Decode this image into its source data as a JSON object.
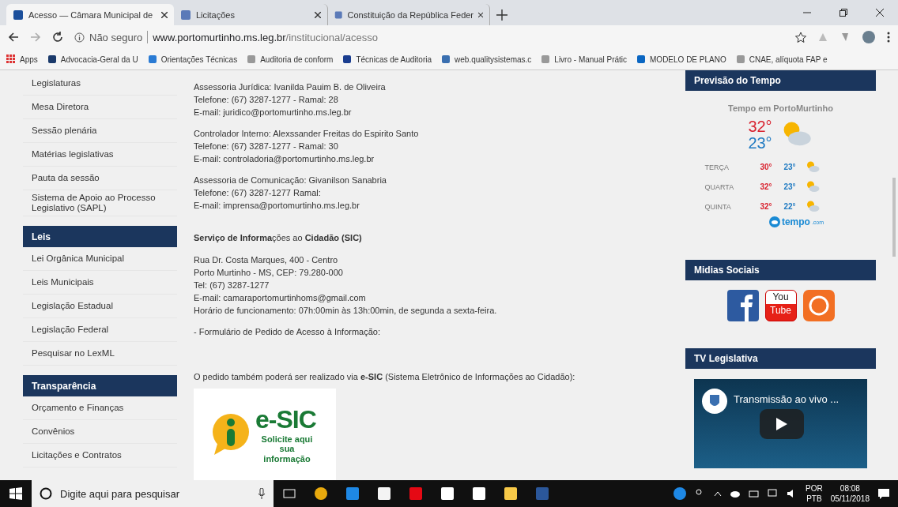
{
  "browser": {
    "tabs": [
      {
        "title": "Acesso — Câmara Municipal de",
        "selected": true
      },
      {
        "title": "Licitações",
        "selected": false
      },
      {
        "title": "Constituição da República Feder",
        "selected": false
      }
    ],
    "address": {
      "security": "Não seguro",
      "host": "www.portomurtinho.ms.leg.br",
      "path": "/institucional/acesso"
    },
    "bookmarks": [
      "Apps",
      "Advocacia-Geral da U",
      "Orientações Técnicas",
      "Auditoria de conform",
      "Técnicas de Auditoria",
      "web.qualitysistemas.c",
      "Livro - Manual Prátic",
      "MODELO DE PLANO",
      "CNAE, alíquota FAP e"
    ]
  },
  "sidebar": {
    "groups": [
      {
        "items": [
          "Legislaturas",
          "Mesa Diretora",
          "Sessão plenária",
          "Matérias legislativas",
          "Pauta da sessão",
          "Sistema de Apoio ao Processo Legislativo (SAPL)"
        ]
      },
      {
        "title": "Leis",
        "items": [
          "Lei Orgânica Municipal",
          "Leis Municipais",
          "Legislação Estadual",
          "Legislação Federal",
          "Pesquisar no LexML"
        ]
      },
      {
        "title": "Transparência",
        "items": [
          "Orçamento e Finanças",
          "Convênios",
          "Licitações e Contratos"
        ]
      }
    ]
  },
  "content": {
    "blocks": [
      {
        "kind": "lines",
        "lines": [
          "Assessoria Jurídica: Ivanilda Pauim B. de Oliveira",
          "Telefone: (67) 3287-1277 - Ramal: 28",
          "E-mail: juridico@portomurtinho.ms.leg.br"
        ]
      },
      {
        "kind": "lines",
        "lines": [
          "Controlador Interno: Alexssander Freitas do Espirito Santo",
          "Telefone: (67) 3287-1277 - Ramal: 30",
          "E-mail: controladoria@portomurtinho.ms.leg.br"
        ]
      },
      {
        "kind": "lines",
        "lines": [
          "Assessoria de Comunicação: Givanilson Sanabria",
          "Telefone: (67) 3287-1277 Ramal:",
          "E-mail: imprensa@portomurtinho.ms.leg.br"
        ]
      },
      {
        "kind": "heading",
        "text": "**Serviço de Informa**ções ao **Cidadão (SIC)**"
      },
      {
        "kind": "lines",
        "lines": [
          "Rua Dr. Costa Marques, 400 - Centro",
          "Porto Murtinho - MS, CEP: 79.280-000",
          "Tel: (67) 3287-1277",
          "E-mail: camaraportomurtinhoms@gmail.com",
          "Horário de funcionamento: 07h:00min às 13h:00min, de segunda a sexta-feira."
        ]
      },
      {
        "kind": "lines",
        "lines": [
          "- Formulário de Pedido de Acesso à Informação:"
        ]
      },
      {
        "kind": "spaced",
        "lines": [
          "O pedido também poderá ser realizado via **e-SIC** (Sistema Eletrônico de Informações ao Cidadão):"
        ]
      },
      {
        "kind": "banner",
        "title": "e-SIC",
        "subtitle": "Solicite aqui sua informação"
      }
    ]
  },
  "weather": {
    "title": "Previsão do Tempo",
    "place": "Tempo em PortoMurtinho",
    "high": "32°",
    "low": "23°",
    "days": [
      {
        "day": "TERÇA",
        "high": "30°",
        "low": "23°"
      },
      {
        "day": "QUARTA",
        "high": "32°",
        "low": "23°"
      },
      {
        "day": "QUINTA",
        "high": "32°",
        "low": "22°"
      }
    ],
    "brand": "tempo",
    "brand_suffix": ".com"
  },
  "social": {
    "title": "Midias Sociais",
    "youtube_top": "You",
    "youtube_bottom": "Tube"
  },
  "tv": {
    "title": "TV Legislativa",
    "video_title": "Transmissão ao vivo ..."
  },
  "taskbar": {
    "search_placeholder": "Digite aqui para pesquisar",
    "language": "POR",
    "layout": "PTB",
    "time": "08:08",
    "date": "05/11/2018"
  }
}
